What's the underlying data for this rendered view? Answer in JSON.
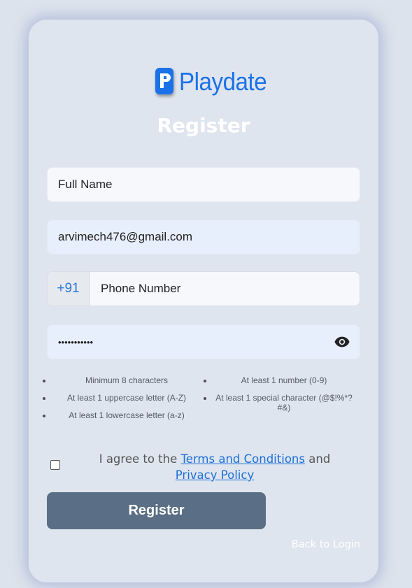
{
  "brand": {
    "name": "Playdate",
    "accent": "#1b72e8"
  },
  "form": {
    "title": "Register",
    "full_name": {
      "placeholder": "Full Name",
      "value": ""
    },
    "email": {
      "value": "arvimech476@gmail.com"
    },
    "phone": {
      "prefix": "+91",
      "placeholder": "Phone Number",
      "value": ""
    },
    "password": {
      "masked_value": "•••••••••••",
      "toggle_icon": "eye-icon"
    }
  },
  "password_rules": {
    "column1": [
      "Minimum 8 characters",
      "At least 1 uppercase letter (A-Z)",
      "At least 1 lowercase letter (a-z)"
    ],
    "column2": [
      "At least 1 number (0-9)",
      "At least 1 special character (@$!%*?#&)"
    ]
  },
  "agreement": {
    "checked": false,
    "prefix": "I agree to the ",
    "terms_link": "Terms and Conditions",
    "conjunction": " and ",
    "privacy_link": "Privacy Policy"
  },
  "actions": {
    "register_label": "Register",
    "register_color": "#5a6f85",
    "back_label": "Back to Login"
  }
}
